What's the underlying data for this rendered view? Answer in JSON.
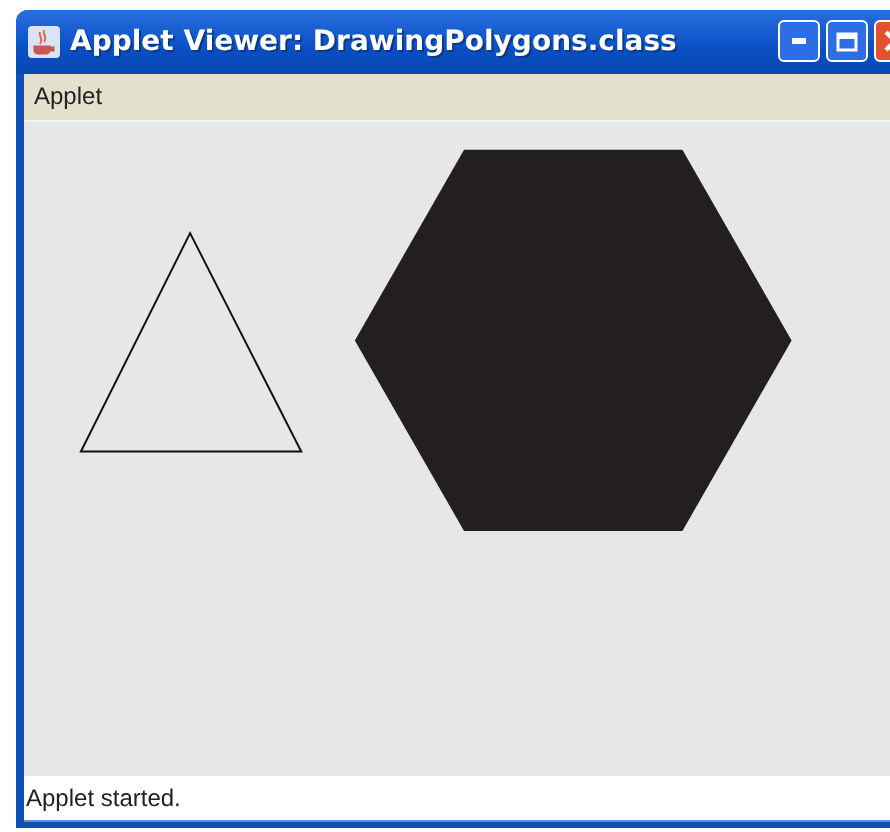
{
  "window": {
    "title": "Applet Viewer: DrawingPolygons.class"
  },
  "menu_bar": [
    "Applet"
  ],
  "status_bar": "Applet started."
}
